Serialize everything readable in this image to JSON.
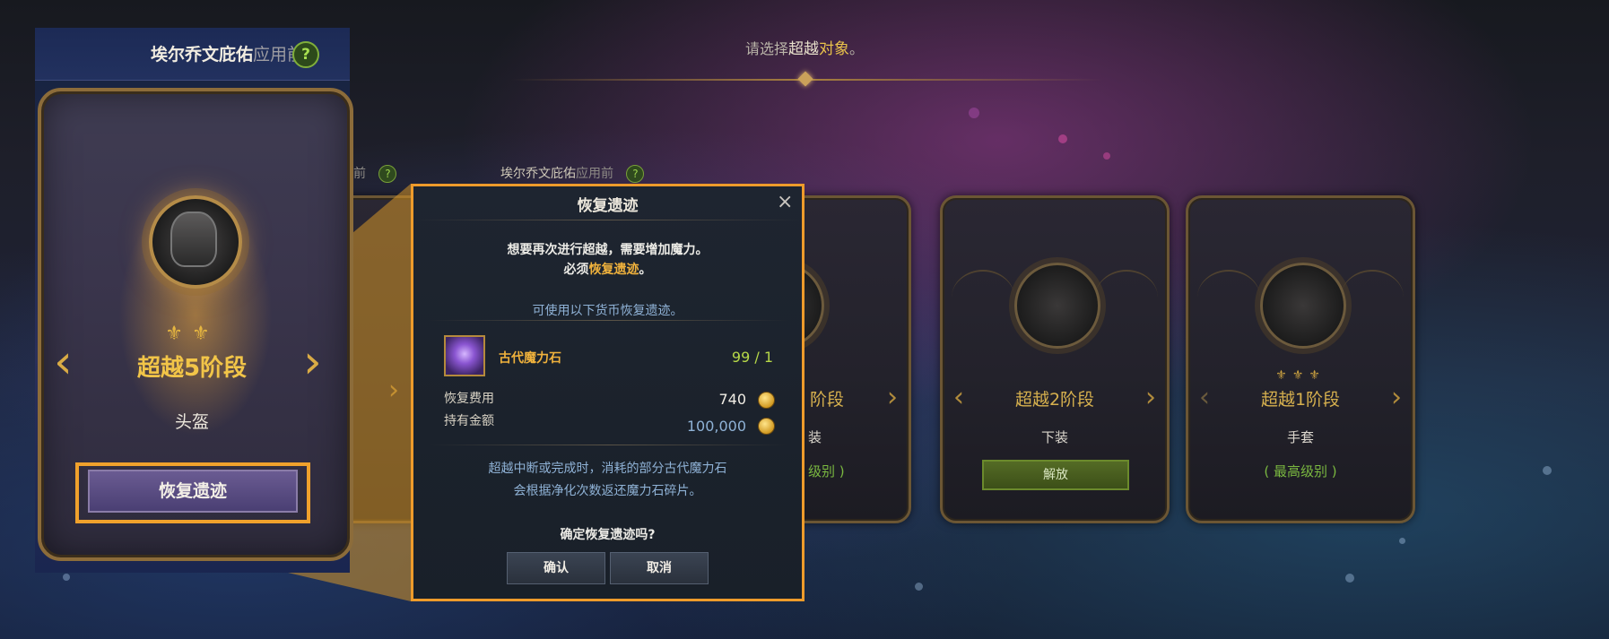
{
  "top_prompt": {
    "part1": "请选择",
    "part2": "超越",
    "part3": "对象",
    "part4": "。"
  },
  "highlight": {
    "header_title": "埃尔乔文庇佑",
    "header_suffix": "应用前",
    "help_badge": "?",
    "stage_label": "超越5阶段",
    "part_name": "头盔",
    "restore_button": "恢复遗迹",
    "icon": "helmet-icon"
  },
  "background_cards": {
    "pre_header_title": "埃尔乔文庇佑",
    "pre_header_suffix": "应用前",
    "pre_header_fragment": "用前",
    "help_badge": "?",
    "card2": {
      "stage_label": "阶段",
      "part_name": "装",
      "max_level": "级别 )"
    },
    "card3": {
      "stage_label": "超越2阶段",
      "part_name": "下装",
      "release_button": "解放",
      "icon": "leg-armor-icon"
    },
    "card4": {
      "stage_label": "超越1阶段",
      "part_name": "手套",
      "max_level": "( 最高级别 )",
      "icon": "gauntlet-icon"
    }
  },
  "modal": {
    "title": "恢复遗迹",
    "close_icon": "×",
    "line1": "想要再次进行超越，需要增加魔力。",
    "line2_prefix": "必须",
    "line2_highlight": "恢复遗迹",
    "line2_suffix": "。",
    "currency_notice": "可使用以下货币恢复遗迹。",
    "item": {
      "name": "古代魔力石",
      "count": "99 / 1",
      "icon": "purple-crystal-icon"
    },
    "cost_label": "恢复费用",
    "cost_value": "740",
    "held_label": "持有金额",
    "held_value": "100,000",
    "coin_icon": "gold-coin-icon",
    "info_line1": "超越中断或完成时，消耗的部分古代魔力石",
    "info_line2": "会根据净化次数返还魔力石碎片。",
    "question": "确定恢复遗迹吗?",
    "confirm_button": "确认",
    "cancel_button": "取消"
  },
  "colors": {
    "highlight_border": "#ee9b2b",
    "stage_gold": "#f2c548",
    "max_level_green": "#7ab840",
    "release_green": "#546b25",
    "count_green": "#b6d848"
  }
}
